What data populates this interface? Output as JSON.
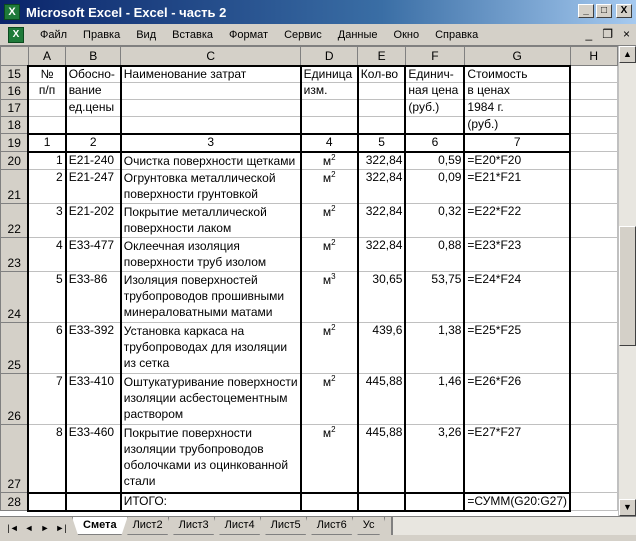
{
  "window": {
    "title": "Microsoft Excel - Excel - часть 2",
    "buttons": {
      "minimize": "_",
      "maximize": "□",
      "close": "X"
    }
  },
  "menu": {
    "items": [
      {
        "label": "Файл"
      },
      {
        "label": "Правка"
      },
      {
        "label": "Вид"
      },
      {
        "label": "Вставка"
      },
      {
        "label": "Формат"
      },
      {
        "label": "Сервис"
      },
      {
        "label": "Данные"
      },
      {
        "label": "Окно"
      },
      {
        "label": "Справка"
      }
    ],
    "doc_buttons": {
      "minimize": "_",
      "restore": "❐",
      "close": "×"
    }
  },
  "columns": [
    "A",
    "B",
    "C",
    "D",
    "E",
    "F",
    "G",
    "H"
  ],
  "header_rows": {
    "numbers": [
      "15",
      "16",
      "17",
      "18"
    ],
    "A": [
      "№",
      "п/п",
      "",
      ""
    ],
    "B": [
      "Обосно-",
      "вание",
      "ед.цены",
      ""
    ],
    "C": [
      "Наименование затрат",
      "",
      "",
      ""
    ],
    "D": [
      "Единица",
      "изм.",
      "",
      ""
    ],
    "E": [
      "Кол-во",
      "",
      "",
      ""
    ],
    "F": [
      "Единич-",
      "ная цена",
      "(руб.)",
      ""
    ],
    "G": [
      "Стоимость",
      "в ценах",
      "1984 г.",
      "(руб.)"
    ]
  },
  "index_row": {
    "number": "19",
    "values": [
      "1",
      "2",
      "3",
      "4",
      "5",
      "6",
      "7"
    ]
  },
  "rows": [
    {
      "row": "20",
      "a": "1",
      "b": "E21-240",
      "c": "Очистка поверхности щетками",
      "unit": "м",
      "exp": "2",
      "e": "322,84",
      "f": "0,59",
      "g": "=E20*F20"
    },
    {
      "row": "21",
      "a": "2",
      "b": "E21-247",
      "c": "Огрунтовка металлической поверхности грунтовкой",
      "unit": "м",
      "exp": "2",
      "e": "322,84",
      "f": "0,09",
      "g": "=E21*F21"
    },
    {
      "row": "22",
      "a": "3",
      "b": "E21-202",
      "c": "Покрытие металлической поверхности лаком",
      "unit": "м",
      "exp": "2",
      "e": "322,84",
      "f": "0,32",
      "g": "=E22*F22"
    },
    {
      "row": "23",
      "a": "4",
      "b": "E33-477",
      "c": "Оклеечная изоляция поверхности труб изолом",
      "unit": "м",
      "exp": "2",
      "e": "322,84",
      "f": "0,88",
      "g": "=E23*F23"
    },
    {
      "row": "24",
      "a": "5",
      "b": "E33-86",
      "c": "Изоляция поверхностей трубопроводов прошивными минераловатными матами",
      "unit": "м",
      "exp": "3",
      "e": "30,65",
      "f": "53,75",
      "g": "=E24*F24"
    },
    {
      "row": "25",
      "a": "6",
      "b": "E33-392",
      "c": "Установка каркаса на трубопроводах для изоляции из сетка",
      "unit": "м",
      "exp": "2",
      "e": "439,6",
      "f": "1,38",
      "g": "=E25*F25"
    },
    {
      "row": "26",
      "a": "7",
      "b": "E33-410",
      "c": "Оштукатуривание поверхности изоляции асбестоцементным раствором",
      "unit": "м",
      "exp": "2",
      "e": "445,88",
      "f": "1,46",
      "g": "=E26*F26"
    },
    {
      "row": "27",
      "a": "8",
      "b": "E33-460",
      "c": "Покрытие поверхности изоляции трубопроводов оболочками из оцинкованной стали",
      "unit": "м",
      "exp": "2",
      "e": "445,88",
      "f": "3,26",
      "g": "=E27*F27"
    }
  ],
  "total_row": {
    "row": "28",
    "label": "ИТОГО:",
    "g": "=СУММ(G20:G27)"
  },
  "sheet_tabs": [
    "Смета",
    "Лист2",
    "Лист3",
    "Лист4",
    "Лист5",
    "Лист6",
    "Ус"
  ],
  "active_tab": "Смета"
}
